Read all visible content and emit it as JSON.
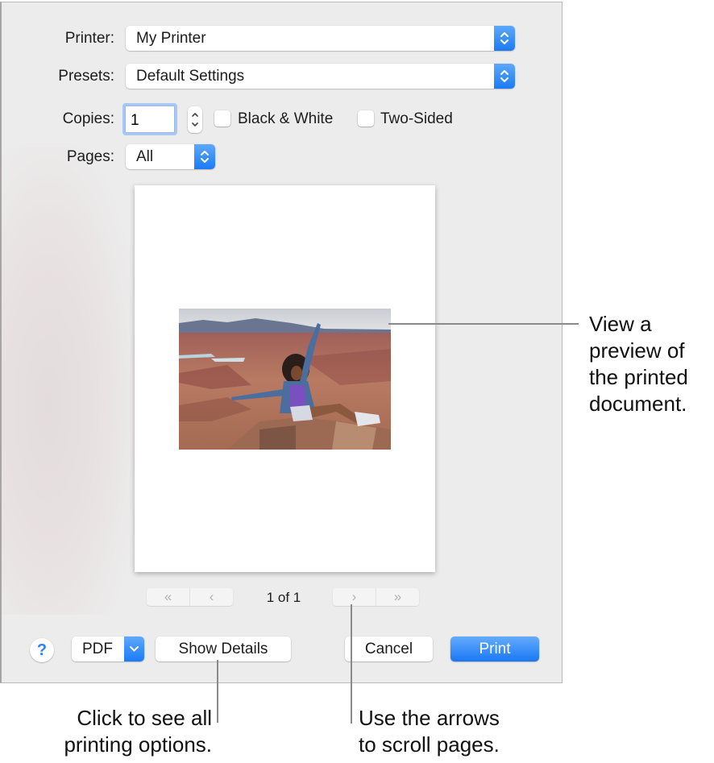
{
  "dialog": {
    "printer": {
      "label": "Printer:",
      "value": "My Printer"
    },
    "presets": {
      "label": "Presets:",
      "value": "Default Settings"
    },
    "copies": {
      "label": "Copies:",
      "value": "1"
    },
    "black_white": {
      "label": "Black & White",
      "checked": false
    },
    "two_sided": {
      "label": "Two-Sided",
      "checked": false
    },
    "pages": {
      "label": "Pages:",
      "value": "All"
    },
    "preview": {
      "page_indicator": "1 of 1",
      "image_description": "Woman posing on a rock above a red canyon landscape"
    },
    "pager": {
      "first": "«",
      "prev": "‹",
      "next": "›",
      "last": "»"
    },
    "buttons": {
      "help": "?",
      "pdf": "PDF",
      "show_details": "Show Details",
      "cancel": "Cancel",
      "print": "Print"
    },
    "accent_color": "#1b7bf7"
  },
  "callouts": {
    "preview": "View a preview of the printed document.",
    "preview_lines": [
      "View a",
      "preview of",
      "the printed",
      "document."
    ],
    "show_details": [
      "Click to see all",
      "printing options."
    ],
    "arrows": [
      "Use the arrows",
      "to scroll pages."
    ]
  }
}
